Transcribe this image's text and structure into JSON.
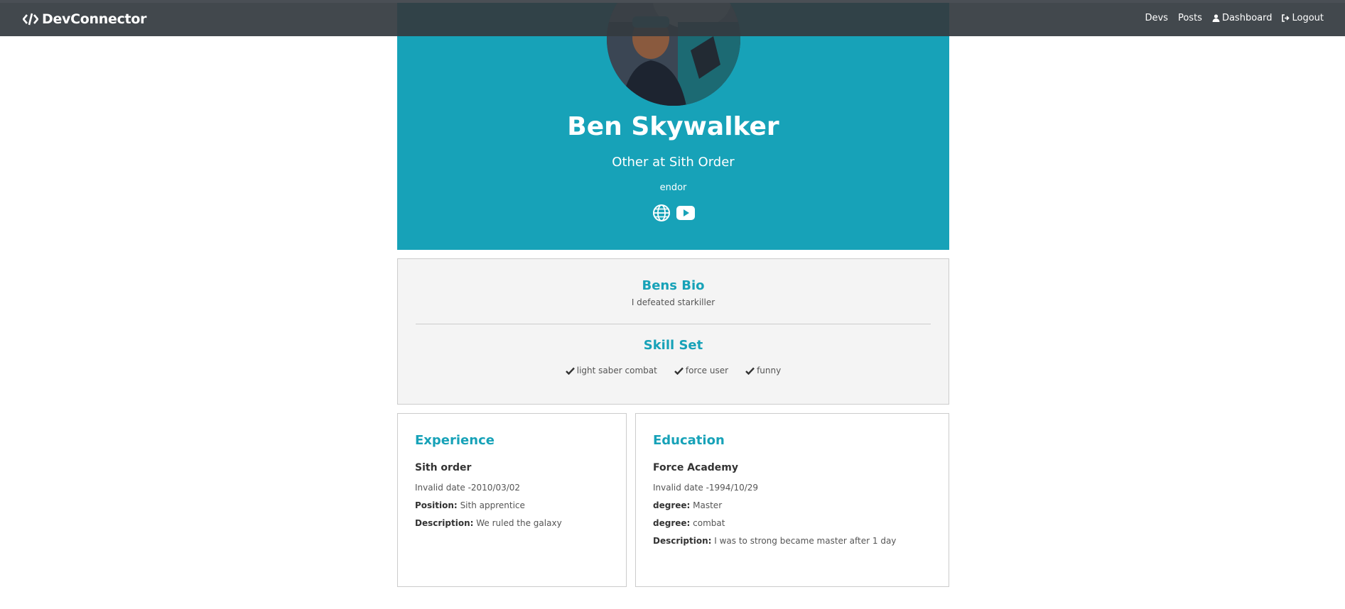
{
  "navbar": {
    "brand": "DevConnector",
    "links": {
      "devs": "Devs",
      "posts": "Posts",
      "dashboard": "Dashboard",
      "logout": "Logout"
    }
  },
  "profile": {
    "name": "Ben Skywalker",
    "status": "Other at Sith Order",
    "location": "endor",
    "social_icons": [
      "globe-icon",
      "youtube-icon"
    ]
  },
  "bio": {
    "title": "Bens Bio",
    "text": "I defeated starkiller",
    "skills_title": "Skill Set",
    "skills": [
      "light saber combat",
      "force user",
      "funny"
    ]
  },
  "experience": {
    "title": "Experience",
    "company": "Sith order",
    "dates": "Invalid date -2010/03/02",
    "position_label": "Position:",
    "position": "Sith apprentice",
    "description_label": "Description:",
    "description": "We ruled the galaxy"
  },
  "education": {
    "title": "Education",
    "school": "Force Academy",
    "dates": "Invalid date -1994/10/29",
    "degree_label": "degree:",
    "degree": "Master",
    "field_label": "degree:",
    "field": "combat",
    "description_label": "Description:",
    "description": "I was to strong became master after 1 day"
  },
  "colors": {
    "accent": "#17a2b8",
    "navbar": "#343a40",
    "bio_bg": "#f4f4f4"
  }
}
